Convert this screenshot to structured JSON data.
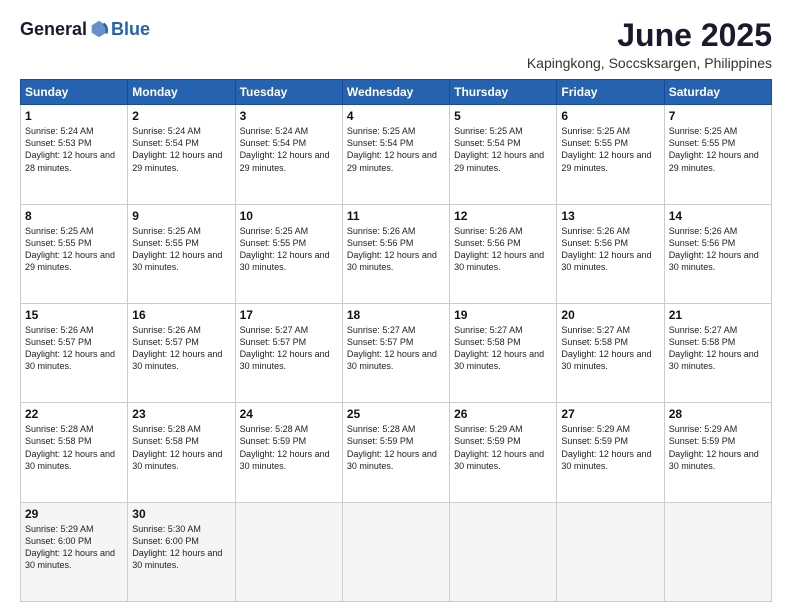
{
  "header": {
    "logo_general": "General",
    "logo_blue": "Blue",
    "main_title": "June 2025",
    "subtitle": "Kapingkong, Soccsksargen, Philippines"
  },
  "days_of_week": [
    "Sunday",
    "Monday",
    "Tuesday",
    "Wednesday",
    "Thursday",
    "Friday",
    "Saturday"
  ],
  "weeks": [
    [
      {
        "day": "1",
        "sunrise": "5:24 AM",
        "sunset": "5:53 PM",
        "daylight": "12 hours and 28 minutes."
      },
      {
        "day": "2",
        "sunrise": "5:24 AM",
        "sunset": "5:54 PM",
        "daylight": "12 hours and 29 minutes."
      },
      {
        "day": "3",
        "sunrise": "5:24 AM",
        "sunset": "5:54 PM",
        "daylight": "12 hours and 29 minutes."
      },
      {
        "day": "4",
        "sunrise": "5:25 AM",
        "sunset": "5:54 PM",
        "daylight": "12 hours and 29 minutes."
      },
      {
        "day": "5",
        "sunrise": "5:25 AM",
        "sunset": "5:54 PM",
        "daylight": "12 hours and 29 minutes."
      },
      {
        "day": "6",
        "sunrise": "5:25 AM",
        "sunset": "5:55 PM",
        "daylight": "12 hours and 29 minutes."
      },
      {
        "day": "7",
        "sunrise": "5:25 AM",
        "sunset": "5:55 PM",
        "daylight": "12 hours and 29 minutes."
      }
    ],
    [
      {
        "day": "8",
        "sunrise": "5:25 AM",
        "sunset": "5:55 PM",
        "daylight": "12 hours and 29 minutes."
      },
      {
        "day": "9",
        "sunrise": "5:25 AM",
        "sunset": "5:55 PM",
        "daylight": "12 hours and 30 minutes."
      },
      {
        "day": "10",
        "sunrise": "5:25 AM",
        "sunset": "5:55 PM",
        "daylight": "12 hours and 30 minutes."
      },
      {
        "day": "11",
        "sunrise": "5:26 AM",
        "sunset": "5:56 PM",
        "daylight": "12 hours and 30 minutes."
      },
      {
        "day": "12",
        "sunrise": "5:26 AM",
        "sunset": "5:56 PM",
        "daylight": "12 hours and 30 minutes."
      },
      {
        "day": "13",
        "sunrise": "5:26 AM",
        "sunset": "5:56 PM",
        "daylight": "12 hours and 30 minutes."
      },
      {
        "day": "14",
        "sunrise": "5:26 AM",
        "sunset": "5:56 PM",
        "daylight": "12 hours and 30 minutes."
      }
    ],
    [
      {
        "day": "15",
        "sunrise": "5:26 AM",
        "sunset": "5:57 PM",
        "daylight": "12 hours and 30 minutes."
      },
      {
        "day": "16",
        "sunrise": "5:26 AM",
        "sunset": "5:57 PM",
        "daylight": "12 hours and 30 minutes."
      },
      {
        "day": "17",
        "sunrise": "5:27 AM",
        "sunset": "5:57 PM",
        "daylight": "12 hours and 30 minutes."
      },
      {
        "day": "18",
        "sunrise": "5:27 AM",
        "sunset": "5:57 PM",
        "daylight": "12 hours and 30 minutes."
      },
      {
        "day": "19",
        "sunrise": "5:27 AM",
        "sunset": "5:58 PM",
        "daylight": "12 hours and 30 minutes."
      },
      {
        "day": "20",
        "sunrise": "5:27 AM",
        "sunset": "5:58 PM",
        "daylight": "12 hours and 30 minutes."
      },
      {
        "day": "21",
        "sunrise": "5:27 AM",
        "sunset": "5:58 PM",
        "daylight": "12 hours and 30 minutes."
      }
    ],
    [
      {
        "day": "22",
        "sunrise": "5:28 AM",
        "sunset": "5:58 PM",
        "daylight": "12 hours and 30 minutes."
      },
      {
        "day": "23",
        "sunrise": "5:28 AM",
        "sunset": "5:58 PM",
        "daylight": "12 hours and 30 minutes."
      },
      {
        "day": "24",
        "sunrise": "5:28 AM",
        "sunset": "5:59 PM",
        "daylight": "12 hours and 30 minutes."
      },
      {
        "day": "25",
        "sunrise": "5:28 AM",
        "sunset": "5:59 PM",
        "daylight": "12 hours and 30 minutes."
      },
      {
        "day": "26",
        "sunrise": "5:29 AM",
        "sunset": "5:59 PM",
        "daylight": "12 hours and 30 minutes."
      },
      {
        "day": "27",
        "sunrise": "5:29 AM",
        "sunset": "5:59 PM",
        "daylight": "12 hours and 30 minutes."
      },
      {
        "day": "28",
        "sunrise": "5:29 AM",
        "sunset": "5:59 PM",
        "daylight": "12 hours and 30 minutes."
      }
    ],
    [
      {
        "day": "29",
        "sunrise": "5:29 AM",
        "sunset": "6:00 PM",
        "daylight": "12 hours and 30 minutes."
      },
      {
        "day": "30",
        "sunrise": "5:30 AM",
        "sunset": "6:00 PM",
        "daylight": "12 hours and 30 minutes."
      },
      null,
      null,
      null,
      null,
      null
    ]
  ]
}
